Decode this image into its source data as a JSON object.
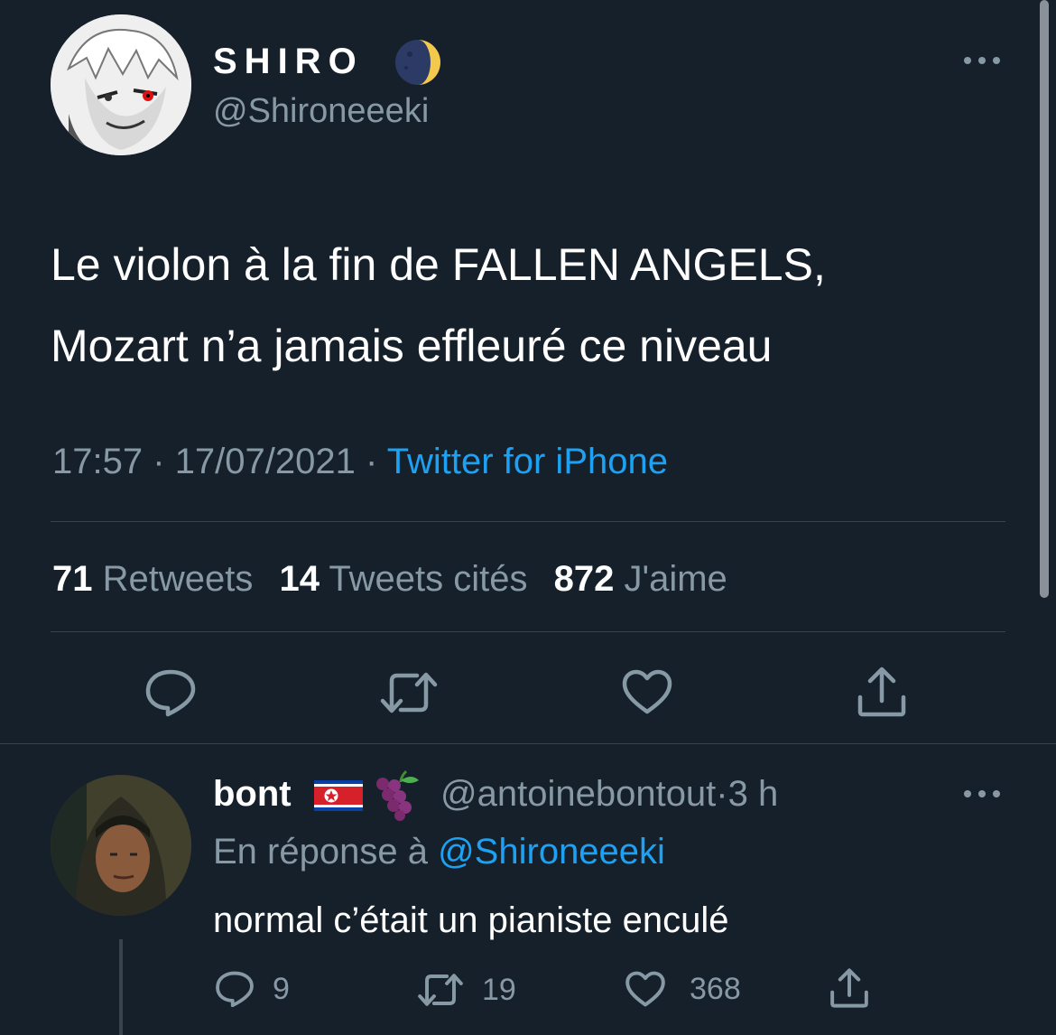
{
  "tweet": {
    "author": {
      "display_name": "SHIRO",
      "handle": "@Shironeeeki",
      "avatar_icon": "anime-avatar",
      "name_emoji": "moon-emoji"
    },
    "more_icon": "more-dots-icon",
    "text_line1": "Le violon à la fin de FALLEN ANGELS,",
    "text_line2": "Mozart n’a jamais effleuré ce niveau",
    "time": "17:57",
    "date": "17/07/2021",
    "sep1": "·",
    "sep2": "·",
    "source": "Twitter for iPhone",
    "stats": {
      "retweets_count": "71",
      "retweets_label": "Retweets",
      "quotes_count": "14",
      "quotes_label": "Tweets cités",
      "likes_count": "872",
      "likes_label": "J'aime"
    },
    "actions": [
      "reply-icon",
      "retweet-icon",
      "like-icon",
      "share-icon"
    ]
  },
  "reply": {
    "author": {
      "display_name": "bont",
      "handle": "@antoinebontout",
      "sep": "·",
      "time": "3 h",
      "flag_emoji": "north-korea-flag-emoji",
      "grapes_emoji": "grapes-emoji"
    },
    "in_reply_to_label": "En réponse à",
    "in_reply_to_handle": "@Shironeeeki",
    "text": "normal c’était un pianiste enculé",
    "replies": "9",
    "retweets": "19",
    "likes": "368"
  },
  "colors": {
    "background": "#15202b",
    "muted": "#8899a6",
    "link": "#1da1f2",
    "divider": "#38444d"
  }
}
